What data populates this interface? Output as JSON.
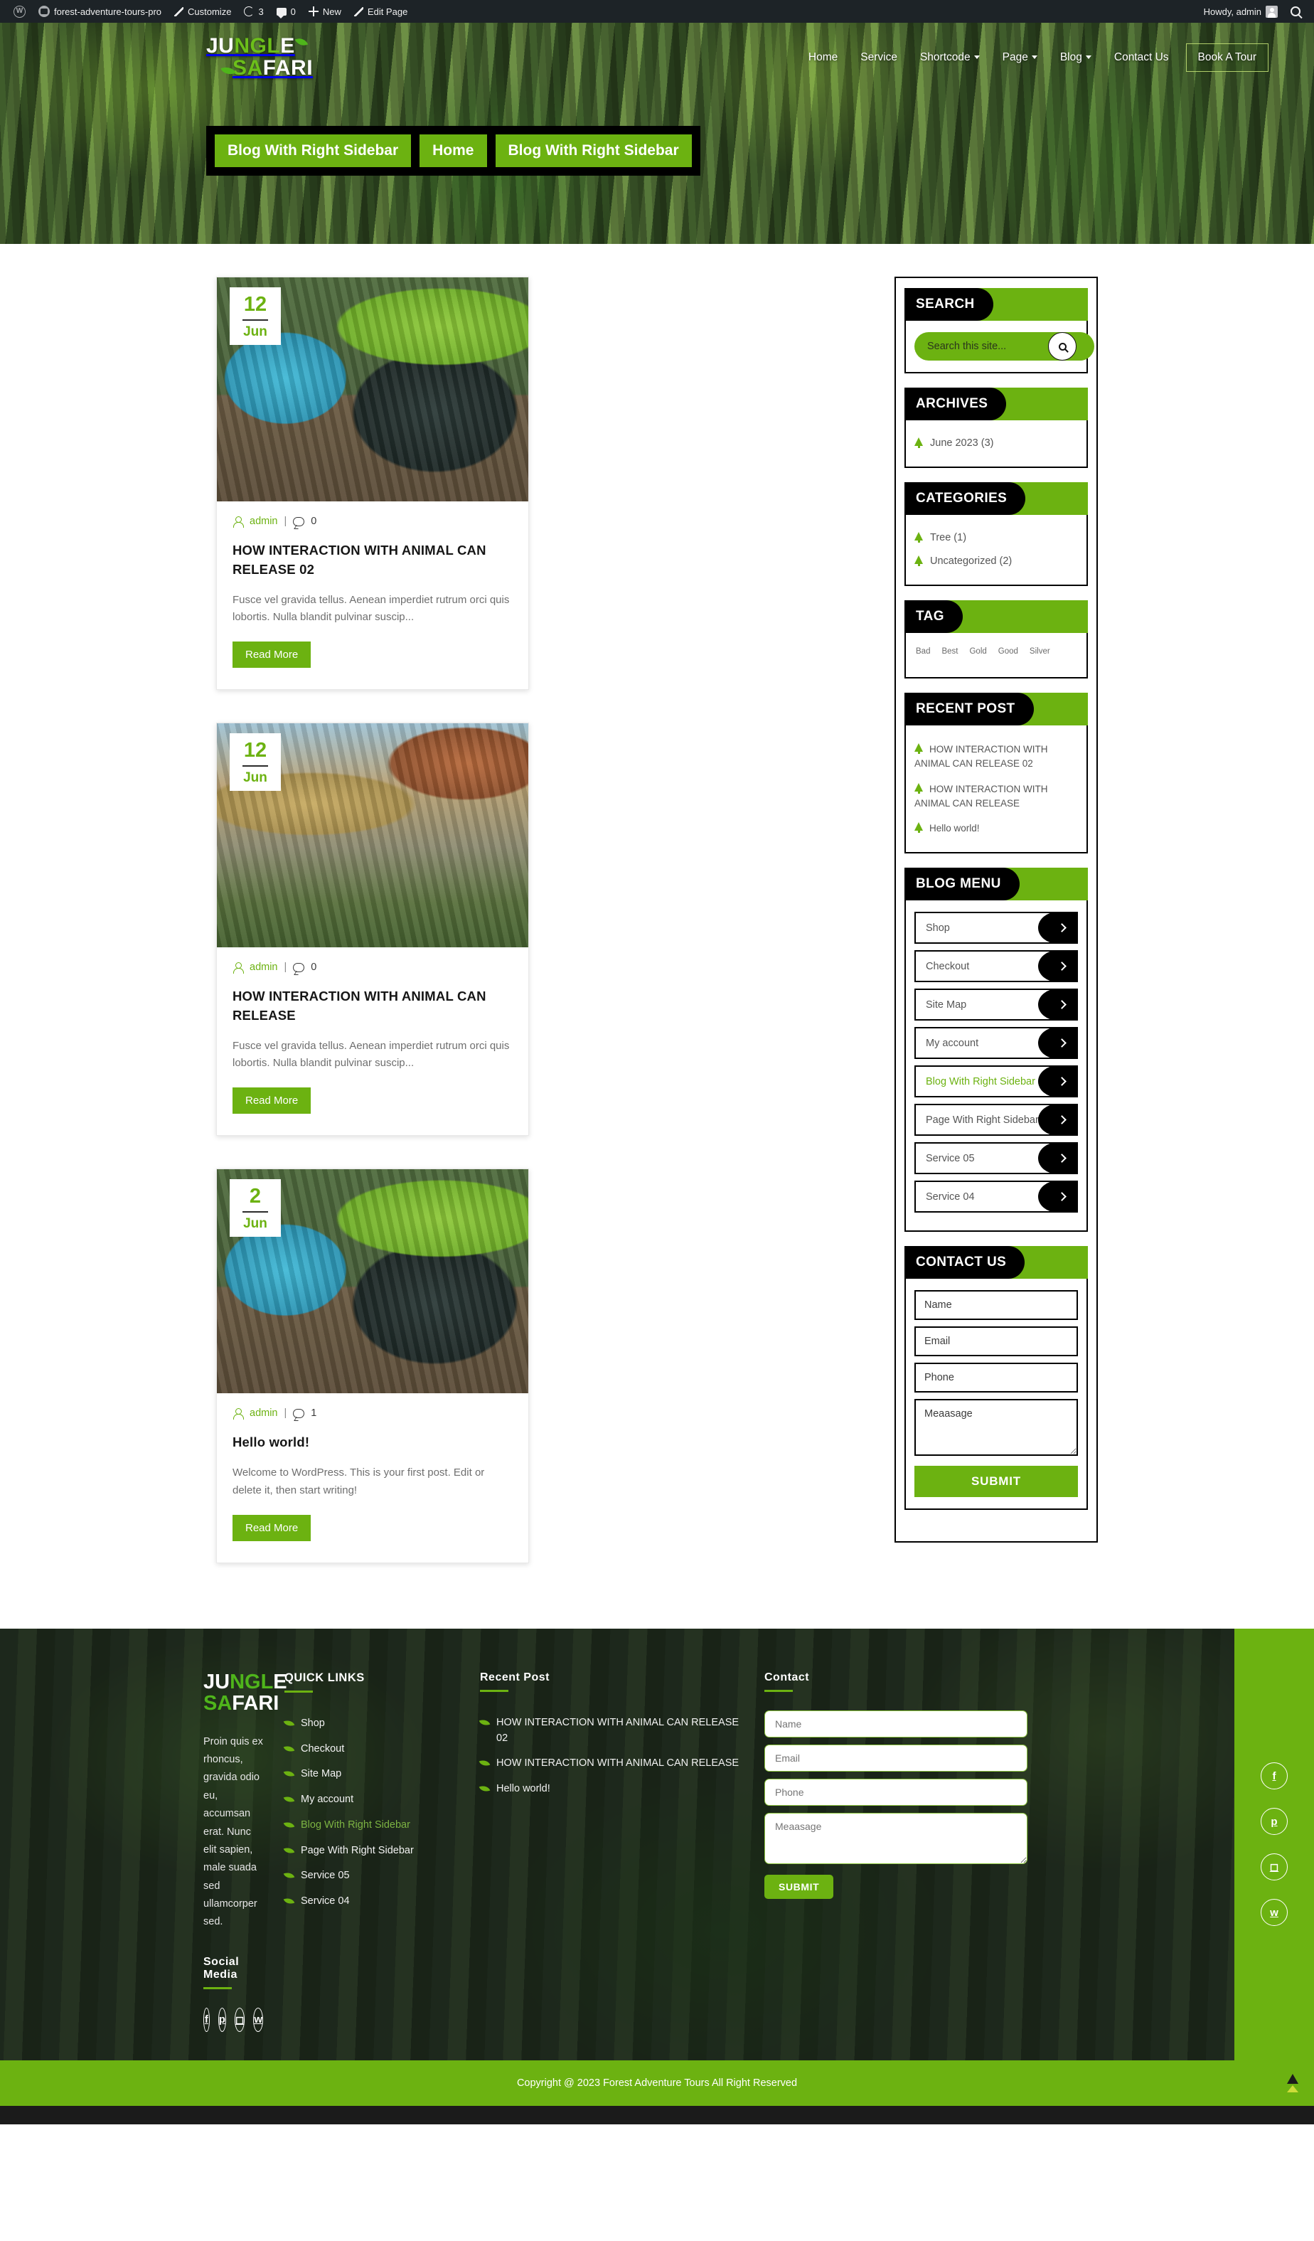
{
  "adminbar": {
    "site_name": "forest-adventure-tours-pro",
    "customize": "Customize",
    "updates_count": "3",
    "comments_count": "0",
    "new": "New",
    "edit_page": "Edit Page",
    "howdy": "Howdy, admin"
  },
  "header": {
    "logo_line1_white1": "JU",
    "logo_line1_green": "NGL",
    "logo_line1_white2": "E",
    "logo_line2_green": "SA",
    "logo_line2_white": "FARI",
    "nav": [
      {
        "label": "Home",
        "caret": false
      },
      {
        "label": "Service",
        "caret": false
      },
      {
        "label": "Shortcode",
        "caret": true
      },
      {
        "label": "Page",
        "caret": true
      },
      {
        "label": "Blog",
        "caret": true
      },
      {
        "label": "Contact Us",
        "caret": false
      }
    ],
    "cta": "Book A Tour",
    "breadcrumb": [
      "Blog With Right Sidebar",
      "Home",
      "Blog With Right Sidebar"
    ]
  },
  "posts": [
    {
      "day": "12",
      "month": "Jun",
      "author": "admin",
      "comments": "0",
      "title": "HOW INTERACTION WITH ANIMAL CAN RELEASE 02",
      "excerpt": "Fusce vel gravida tellus. Aenean imperdiet rutrum orci quis lobortis. Nulla blandit pulvinar suscip...",
      "readmore": "Read More"
    },
    {
      "day": "12",
      "month": "Jun",
      "author": "admin",
      "comments": "0",
      "title": "HOW INTERACTION WITH ANIMAL CAN RELEASE",
      "excerpt": "Fusce vel gravida tellus. Aenean imperdiet rutrum orci quis lobortis. Nulla blandit pulvinar suscip...",
      "readmore": "Read More"
    },
    {
      "day": "2",
      "month": "Jun",
      "author": "admin",
      "comments": "1",
      "title": "Hello world!",
      "excerpt": "Welcome to WordPress. This is your first post. Edit or delete it, then start writing!",
      "readmore": "Read More"
    }
  ],
  "sidebar": {
    "search": {
      "title": "SEARCH",
      "placeholder": "Search this site...",
      "value": ""
    },
    "archives": {
      "title": "ARCHIVES",
      "items": [
        "June 2023 (3)"
      ]
    },
    "categories": {
      "title": "CATEGORIES",
      "items": [
        "Tree (1)",
        "Uncategorized (2)"
      ]
    },
    "tag": {
      "title": "TAG",
      "items": [
        "Bad",
        "Best",
        "Gold",
        "Good",
        "Silver"
      ]
    },
    "recent": {
      "title": "RECENT POST",
      "items": [
        "HOW INTERACTION WITH ANIMAL CAN RELEASE 02",
        "HOW INTERACTION WITH ANIMAL CAN RELEASE",
        "Hello world!"
      ]
    },
    "blogmenu": {
      "title": "BLOG MENU",
      "items": [
        {
          "label": "Shop",
          "current": false
        },
        {
          "label": "Checkout",
          "current": false
        },
        {
          "label": "Site Map",
          "current": false
        },
        {
          "label": "My account",
          "current": false
        },
        {
          "label": "Blog With Right Sidebar",
          "current": true
        },
        {
          "label": "Page With Right Sidebar",
          "current": false
        },
        {
          "label": "Service 05",
          "current": false
        },
        {
          "label": "Service 04",
          "current": false
        }
      ]
    },
    "contact": {
      "title": "CONTACT US",
      "name_placeholder": "Name",
      "email_placeholder": "Email",
      "phone_placeholder": "Phone",
      "message_placeholder": "Meaasage",
      "submit": "SUBMIT"
    }
  },
  "footer": {
    "logo_line1_white1": "JU",
    "logo_line1_green": "NGL",
    "logo_line1_white2": "E",
    "logo_line2_green": "SA",
    "logo_line2_white": "FARI",
    "about": "Proin quis ex rhoncus, gravida odio eu, accumsan erat. Nunc elit sapien, male suada sed ullamcorper sed.",
    "social_media_label": "Social Media",
    "quick_links_title": "QUICK LINKS",
    "quick_links": [
      {
        "label": "Shop",
        "current": false
      },
      {
        "label": "Checkout",
        "current": false
      },
      {
        "label": "Site Map",
        "current": false
      },
      {
        "label": "My account",
        "current": false
      },
      {
        "label": "Blog With Right Sidebar",
        "current": true
      },
      {
        "label": "Page With Right Sidebar",
        "current": false
      },
      {
        "label": "Service 05",
        "current": false
      },
      {
        "label": "Service 04",
        "current": false
      }
    ],
    "recent_title": "Recent Post",
    "recent_posts": [
      "HOW INTERACTION WITH ANIMAL CAN RELEASE 02",
      "HOW INTERACTION WITH ANIMAL CAN RELEASE",
      "Hello world!"
    ],
    "contact_title": "Contact",
    "name_placeholder": "Name",
    "email_placeholder": "Email",
    "phone_placeholder": "Phone",
    "message_placeholder": "Meaasage",
    "submit": "SUBMIT",
    "copyright": "Copyright @ 2023 Forest Adventure Tours All Right Reserved"
  },
  "colors": {
    "accent_green": "#6cb211",
    "dark": "#000000",
    "adminbar_bg": "#1d2327"
  }
}
